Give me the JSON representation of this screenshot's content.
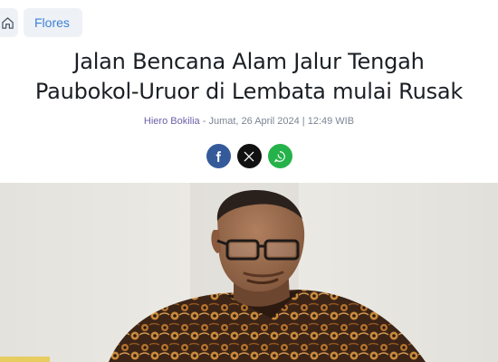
{
  "breadcrumb": {
    "home_icon": "home-icon",
    "category": "Flores"
  },
  "article": {
    "title_line1": "Jalan Bencana Alam Jalur Tengah",
    "title_line2": "Paubokol-Uruor di Lembata mulai Rusak",
    "author": "Hiero Bokilia",
    "separator": " - ",
    "date": "Jumat, 26 April 2024 | 12:49 WIB"
  },
  "share": [
    {
      "name": "facebook",
      "icon": "facebook-icon",
      "color": "#355a9a"
    },
    {
      "name": "x",
      "icon": "x-icon",
      "color": "#111111"
    },
    {
      "name": "whatsapp",
      "icon": "whatsapp-icon",
      "color": "#25b24a"
    }
  ],
  "photo": {
    "subject": "man-with-glasses-batik-shirt"
  }
}
